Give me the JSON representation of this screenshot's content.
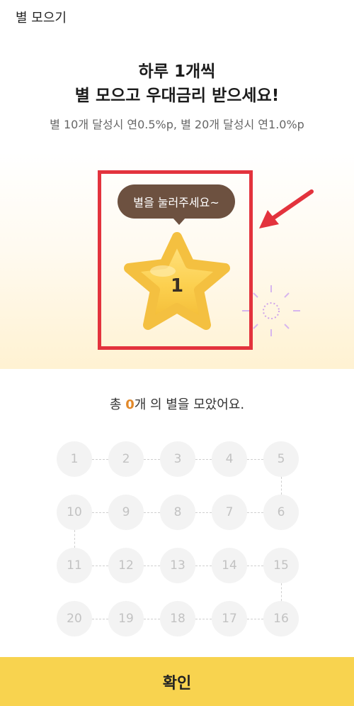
{
  "header": {
    "title": "별 모으기"
  },
  "intro": {
    "line1": "하루 1개씩",
    "line2": "별 모으고 우대금리 받으세요!",
    "subtext": "별 10개 달성시 연0.5%p, 별 20개 달성시 연1.0%p"
  },
  "star_area": {
    "tooltip": "별을 눌러주세요~",
    "star_number": "1"
  },
  "progress": {
    "prefix": "총 ",
    "count": "0",
    "suffix": "개 의 별을 모았어요."
  },
  "stamps": {
    "rows": [
      [
        "1",
        "2",
        "3",
        "4",
        "5"
      ],
      [
        "10",
        "9",
        "8",
        "7",
        "6"
      ],
      [
        "11",
        "12",
        "13",
        "14",
        "15"
      ],
      [
        "20",
        "19",
        "18",
        "17",
        "16"
      ]
    ]
  },
  "footer": {
    "confirm_label": "확인"
  },
  "colors": {
    "accent": "#f8d34f",
    "highlight_border": "#e3333d",
    "tooltip_bg": "#6d5140",
    "count_highlight": "#e2892a"
  }
}
